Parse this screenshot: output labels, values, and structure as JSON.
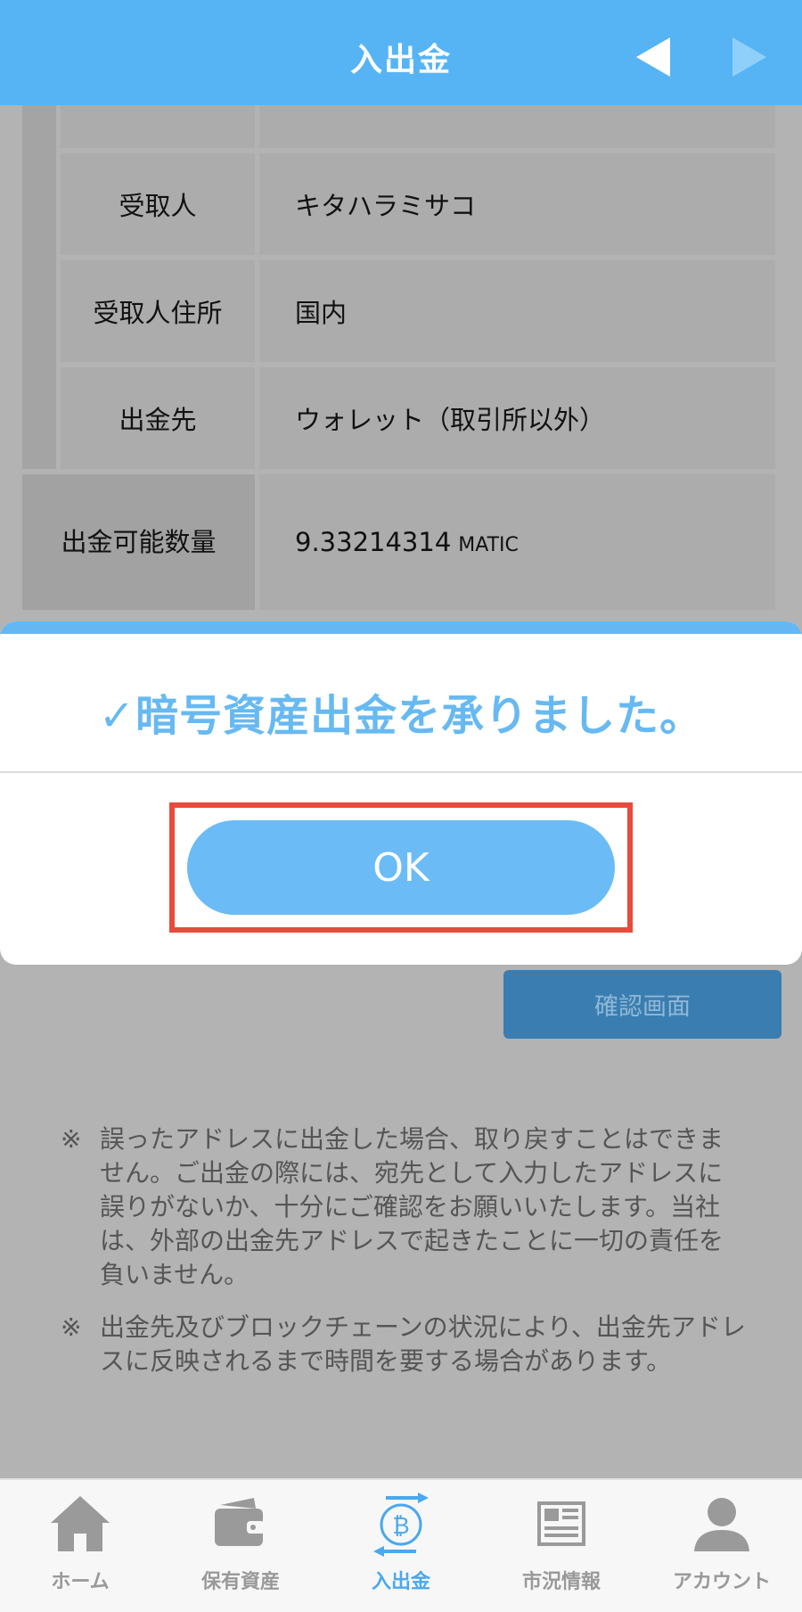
{
  "header": {
    "title": "入出金"
  },
  "table": {
    "rows": [
      {
        "label": "受取人",
        "value": "キタハラミサコ"
      },
      {
        "label": "受取人住所",
        "value": "国内"
      },
      {
        "label": "出金先",
        "value": "ウォレット（取引所以外）"
      },
      {
        "label": "出金可能数量",
        "value": "9.33214314",
        "unit": "MATIC"
      }
    ]
  },
  "confirm_button": "確認画面",
  "notes": [
    {
      "mark": "※",
      "text": "誤ったアドレスに出金した場合、取り戻すことはできません。ご出金の際には、宛先として入力したアドレスに誤りがないか、十分にご確認をお願いいたします。当社は、外部の出金先アドレスで起きたことに一切の責任を負いません。"
    },
    {
      "mark": "※",
      "text": "出金先及びブロックチェーンの状況により、出金先アドレスに反映されるまで時間を要する場合があります。"
    }
  ],
  "modal": {
    "message": "✓暗号資産出金を承りました。",
    "ok_label": "OK"
  },
  "tabs": [
    {
      "label": "ホーム",
      "icon": "home-icon"
    },
    {
      "label": "保有資産",
      "icon": "wallet-icon"
    },
    {
      "label": "入出金",
      "icon": "bitcoin-transfer-icon",
      "active": true
    },
    {
      "label": "市況情報",
      "icon": "newspaper-icon"
    },
    {
      "label": "アカウント",
      "icon": "account-icon"
    }
  ],
  "colors": {
    "header": "#56b4f5",
    "modal_text": "#67b9f2",
    "ok_button": "#6bbcf6",
    "highlight": "#e84b3c",
    "tab_active": "#4aa8ee"
  }
}
